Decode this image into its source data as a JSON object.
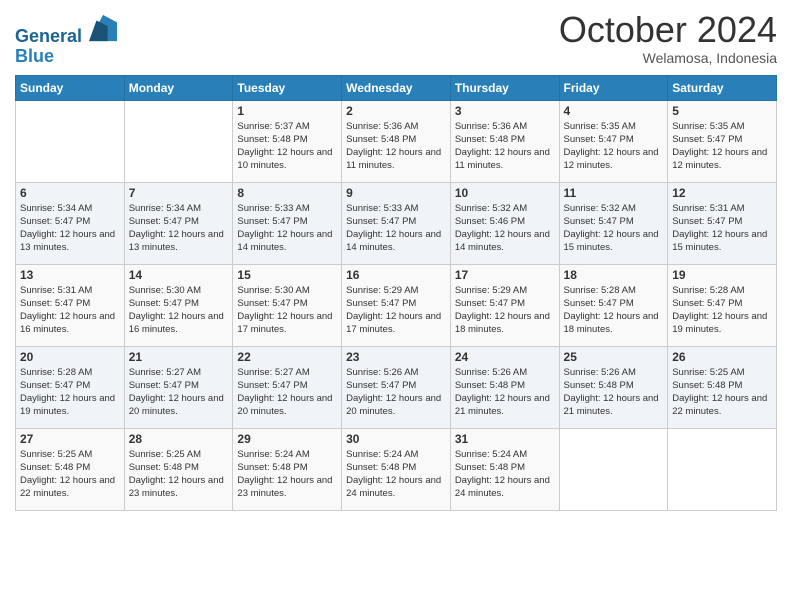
{
  "header": {
    "logo_line1": "General",
    "logo_line2": "Blue",
    "month": "October 2024",
    "location": "Welamosa, Indonesia"
  },
  "weekdays": [
    "Sunday",
    "Monday",
    "Tuesday",
    "Wednesday",
    "Thursday",
    "Friday",
    "Saturday"
  ],
  "weeks": [
    [
      {
        "day": "",
        "sunrise": "",
        "sunset": "",
        "daylight": ""
      },
      {
        "day": "",
        "sunrise": "",
        "sunset": "",
        "daylight": ""
      },
      {
        "day": "1",
        "sunrise": "Sunrise: 5:37 AM",
        "sunset": "Sunset: 5:48 PM",
        "daylight": "Daylight: 12 hours and 10 minutes."
      },
      {
        "day": "2",
        "sunrise": "Sunrise: 5:36 AM",
        "sunset": "Sunset: 5:48 PM",
        "daylight": "Daylight: 12 hours and 11 minutes."
      },
      {
        "day": "3",
        "sunrise": "Sunrise: 5:36 AM",
        "sunset": "Sunset: 5:48 PM",
        "daylight": "Daylight: 12 hours and 11 minutes."
      },
      {
        "day": "4",
        "sunrise": "Sunrise: 5:35 AM",
        "sunset": "Sunset: 5:47 PM",
        "daylight": "Daylight: 12 hours and 12 minutes."
      },
      {
        "day": "5",
        "sunrise": "Sunrise: 5:35 AM",
        "sunset": "Sunset: 5:47 PM",
        "daylight": "Daylight: 12 hours and 12 minutes."
      }
    ],
    [
      {
        "day": "6",
        "sunrise": "Sunrise: 5:34 AM",
        "sunset": "Sunset: 5:47 PM",
        "daylight": "Daylight: 12 hours and 13 minutes."
      },
      {
        "day": "7",
        "sunrise": "Sunrise: 5:34 AM",
        "sunset": "Sunset: 5:47 PM",
        "daylight": "Daylight: 12 hours and 13 minutes."
      },
      {
        "day": "8",
        "sunrise": "Sunrise: 5:33 AM",
        "sunset": "Sunset: 5:47 PM",
        "daylight": "Daylight: 12 hours and 14 minutes."
      },
      {
        "day": "9",
        "sunrise": "Sunrise: 5:33 AM",
        "sunset": "Sunset: 5:47 PM",
        "daylight": "Daylight: 12 hours and 14 minutes."
      },
      {
        "day": "10",
        "sunrise": "Sunrise: 5:32 AM",
        "sunset": "Sunset: 5:46 PM",
        "daylight": "Daylight: 12 hours and 14 minutes."
      },
      {
        "day": "11",
        "sunrise": "Sunrise: 5:32 AM",
        "sunset": "Sunset: 5:47 PM",
        "daylight": "Daylight: 12 hours and 15 minutes."
      },
      {
        "day": "12",
        "sunrise": "Sunrise: 5:31 AM",
        "sunset": "Sunset: 5:47 PM",
        "daylight": "Daylight: 12 hours and 15 minutes."
      }
    ],
    [
      {
        "day": "13",
        "sunrise": "Sunrise: 5:31 AM",
        "sunset": "Sunset: 5:47 PM",
        "daylight": "Daylight: 12 hours and 16 minutes."
      },
      {
        "day": "14",
        "sunrise": "Sunrise: 5:30 AM",
        "sunset": "Sunset: 5:47 PM",
        "daylight": "Daylight: 12 hours and 16 minutes."
      },
      {
        "day": "15",
        "sunrise": "Sunrise: 5:30 AM",
        "sunset": "Sunset: 5:47 PM",
        "daylight": "Daylight: 12 hours and 17 minutes."
      },
      {
        "day": "16",
        "sunrise": "Sunrise: 5:29 AM",
        "sunset": "Sunset: 5:47 PM",
        "daylight": "Daylight: 12 hours and 17 minutes."
      },
      {
        "day": "17",
        "sunrise": "Sunrise: 5:29 AM",
        "sunset": "Sunset: 5:47 PM",
        "daylight": "Daylight: 12 hours and 18 minutes."
      },
      {
        "day": "18",
        "sunrise": "Sunrise: 5:28 AM",
        "sunset": "Sunset: 5:47 PM",
        "daylight": "Daylight: 12 hours and 18 minutes."
      },
      {
        "day": "19",
        "sunrise": "Sunrise: 5:28 AM",
        "sunset": "Sunset: 5:47 PM",
        "daylight": "Daylight: 12 hours and 19 minutes."
      }
    ],
    [
      {
        "day": "20",
        "sunrise": "Sunrise: 5:28 AM",
        "sunset": "Sunset: 5:47 PM",
        "daylight": "Daylight: 12 hours and 19 minutes."
      },
      {
        "day": "21",
        "sunrise": "Sunrise: 5:27 AM",
        "sunset": "Sunset: 5:47 PM",
        "daylight": "Daylight: 12 hours and 20 minutes."
      },
      {
        "day": "22",
        "sunrise": "Sunrise: 5:27 AM",
        "sunset": "Sunset: 5:47 PM",
        "daylight": "Daylight: 12 hours and 20 minutes."
      },
      {
        "day": "23",
        "sunrise": "Sunrise: 5:26 AM",
        "sunset": "Sunset: 5:47 PM",
        "daylight": "Daylight: 12 hours and 20 minutes."
      },
      {
        "day": "24",
        "sunrise": "Sunrise: 5:26 AM",
        "sunset": "Sunset: 5:48 PM",
        "daylight": "Daylight: 12 hours and 21 minutes."
      },
      {
        "day": "25",
        "sunrise": "Sunrise: 5:26 AM",
        "sunset": "Sunset: 5:48 PM",
        "daylight": "Daylight: 12 hours and 21 minutes."
      },
      {
        "day": "26",
        "sunrise": "Sunrise: 5:25 AM",
        "sunset": "Sunset: 5:48 PM",
        "daylight": "Daylight: 12 hours and 22 minutes."
      }
    ],
    [
      {
        "day": "27",
        "sunrise": "Sunrise: 5:25 AM",
        "sunset": "Sunset: 5:48 PM",
        "daylight": "Daylight: 12 hours and 22 minutes."
      },
      {
        "day": "28",
        "sunrise": "Sunrise: 5:25 AM",
        "sunset": "Sunset: 5:48 PM",
        "daylight": "Daylight: 12 hours and 23 minutes."
      },
      {
        "day": "29",
        "sunrise": "Sunrise: 5:24 AM",
        "sunset": "Sunset: 5:48 PM",
        "daylight": "Daylight: 12 hours and 23 minutes."
      },
      {
        "day": "30",
        "sunrise": "Sunrise: 5:24 AM",
        "sunset": "Sunset: 5:48 PM",
        "daylight": "Daylight: 12 hours and 24 minutes."
      },
      {
        "day": "31",
        "sunrise": "Sunrise: 5:24 AM",
        "sunset": "Sunset: 5:48 PM",
        "daylight": "Daylight: 12 hours and 24 minutes."
      },
      {
        "day": "",
        "sunrise": "",
        "sunset": "",
        "daylight": ""
      },
      {
        "day": "",
        "sunrise": "",
        "sunset": "",
        "daylight": ""
      }
    ]
  ]
}
